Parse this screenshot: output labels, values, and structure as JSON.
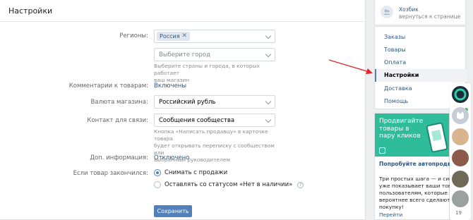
{
  "header": {
    "title": "Настройки"
  },
  "form": {
    "regions_label": "Регионы:",
    "region_token": "Россия",
    "region_token_remove": "✕",
    "city_placeholder": "Выберите город",
    "city_hint_line1": "Выберите страны и города, в которых работает",
    "city_hint_line2": "ваш магазин",
    "comments_label": "Комментарии к товарам:",
    "comments_value": "Включены",
    "currency_label": "Валюта магазина:",
    "currency_value": "Российский рубль",
    "contact_label": "Контакт для связи:",
    "contact_value": "Сообщения сообщества",
    "contact_hint_line1": "Кнопка «Написать продавцу» в карточке товара",
    "contact_hint_line2": "будет открывать переписку с сообществом или",
    "contact_hint_line3": "выбранным руководителем",
    "extra_label": "Доп. информация:",
    "extra_value": "Отключено",
    "out_of_stock_label": "Если товар закончился:",
    "option_remove": "Снимать с продажи",
    "option_keep": "Оставлять со статусом «Нет в наличии»",
    "option_selected": "Снимать с продажи",
    "help_glyph": "?",
    "save_label": "Сохранить"
  },
  "profile": {
    "name": "Хозбик",
    "back_link": "вернуться к странице"
  },
  "menu": {
    "items": [
      {
        "label": "Заказы"
      },
      {
        "label": "Товары"
      },
      {
        "label": "Оплата"
      },
      {
        "label": "Настройки"
      },
      {
        "label": "Доставка"
      },
      {
        "label": "Помощь"
      }
    ],
    "active": "Настройки"
  },
  "ad": {
    "banner_text": "Продвигайте товары в пару кликов",
    "title": "Попробуйте автопродвижение товаров",
    "text_line1": "Три простых шага — и система",
    "text_line2": "уже показывает ваши товары",
    "text_line3": "пользователям, которые",
    "text_line4": "вероятнее всего сделают",
    "text_line5": "покупку!",
    "more_link": "Перейти"
  },
  "chat": {
    "count": "19"
  },
  "colors": {
    "accent": "#5181b8",
    "link": "#2a5885",
    "ad_green": "#2fbc9b",
    "arrow": "#e0262b"
  }
}
